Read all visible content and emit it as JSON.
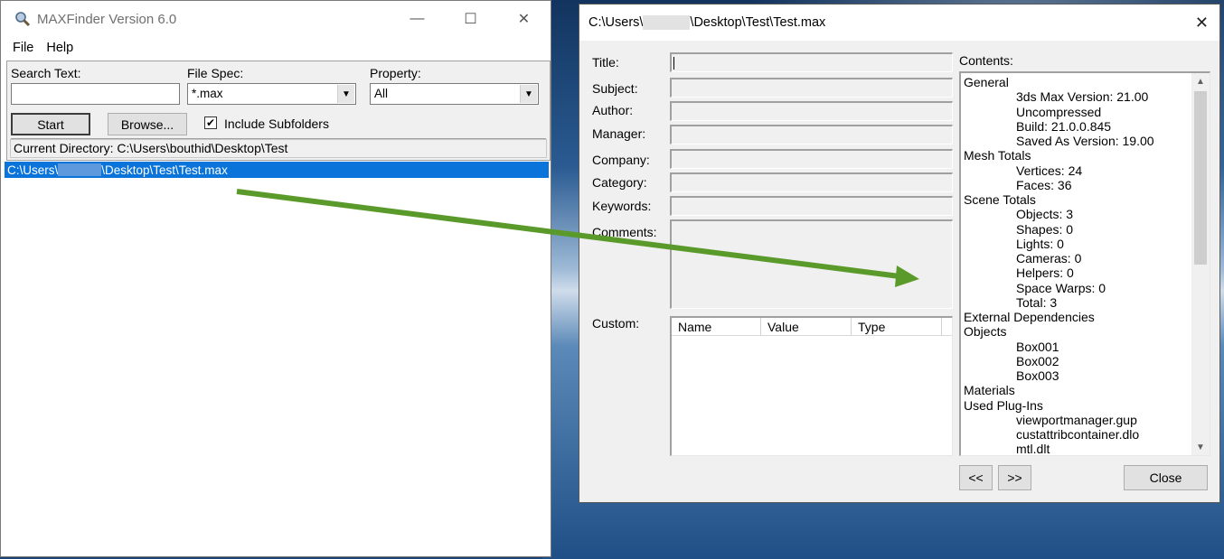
{
  "main_window": {
    "title": "MAXFinder Version 6.0",
    "minimize": "—",
    "maximize": "☐",
    "close": "✕",
    "menu": {
      "file": "File",
      "help": "Help"
    },
    "search": {
      "search_text_label": "Search Text:",
      "search_text_value": "",
      "file_spec_label": "File Spec:",
      "file_spec_value": "*.max",
      "property_label": "Property:",
      "property_value": "All",
      "start_button": "Start",
      "browse_button": "Browse...",
      "include_subfolders_label": "Include Subfolders",
      "include_subfolders_checked": "✔",
      "current_directory": "Current Directory: C:\\Users\\bouthid\\Desktop\\Test"
    },
    "results": [
      {
        "prefix": "C:\\Users\\",
        "suffix": "\\Desktop\\Test\\Test.max"
      }
    ]
  },
  "props_window": {
    "title_prefix": "C:\\Users\\",
    "title_suffix": "\\Desktop\\Test\\Test.max",
    "close": "✕",
    "labels": {
      "title": "Title:",
      "subject": "Subject:",
      "author": "Author:",
      "manager": "Manager:",
      "company": "Company:",
      "category": "Category:",
      "keywords": "Keywords:",
      "comments": "Comments:",
      "custom": "Custom:",
      "contents": "Contents:"
    },
    "custom_columns": [
      "Name",
      "Value",
      "Type"
    ],
    "contents_tree": [
      {
        "text": "General",
        "level": 0
      },
      {
        "text": "3ds Max Version: 21.00",
        "level": 1
      },
      {
        "text": "Uncompressed",
        "level": 1
      },
      {
        "text": "Build: 21.0.0.845",
        "level": 1
      },
      {
        "text": "Saved As Version: 19.00",
        "level": 1
      },
      {
        "text": "Mesh Totals",
        "level": 0
      },
      {
        "text": "Vertices: 24",
        "level": 1
      },
      {
        "text": "Faces: 36",
        "level": 1
      },
      {
        "text": "Scene Totals",
        "level": 0
      },
      {
        "text": "Objects: 3",
        "level": 1
      },
      {
        "text": "Shapes: 0",
        "level": 1
      },
      {
        "text": "Lights: 0",
        "level": 1
      },
      {
        "text": "Cameras: 0",
        "level": 1
      },
      {
        "text": "Helpers: 0",
        "level": 1
      },
      {
        "text": "Space Warps: 0",
        "level": 1
      },
      {
        "text": "Total: 3",
        "level": 1
      },
      {
        "text": "External Dependencies",
        "level": 0
      },
      {
        "text": "Objects",
        "level": 0
      },
      {
        "text": "Box001",
        "level": 1
      },
      {
        "text": "Box002",
        "level": 1
      },
      {
        "text": "Box003",
        "level": 1
      },
      {
        "text": "Materials",
        "level": 0
      },
      {
        "text": "Used Plug-Ins",
        "level": 0
      },
      {
        "text": "viewportmanager.gup",
        "level": 1
      },
      {
        "text": "custattribcontainer.dlo",
        "level": 1
      },
      {
        "text": "mtl.dlt",
        "level": 1
      }
    ],
    "prev_button": "<<",
    "next_button": ">>",
    "close_button": "Close"
  },
  "colors": {
    "selection": "#0a74da",
    "annotation_arrow": "#5a9a2a"
  }
}
